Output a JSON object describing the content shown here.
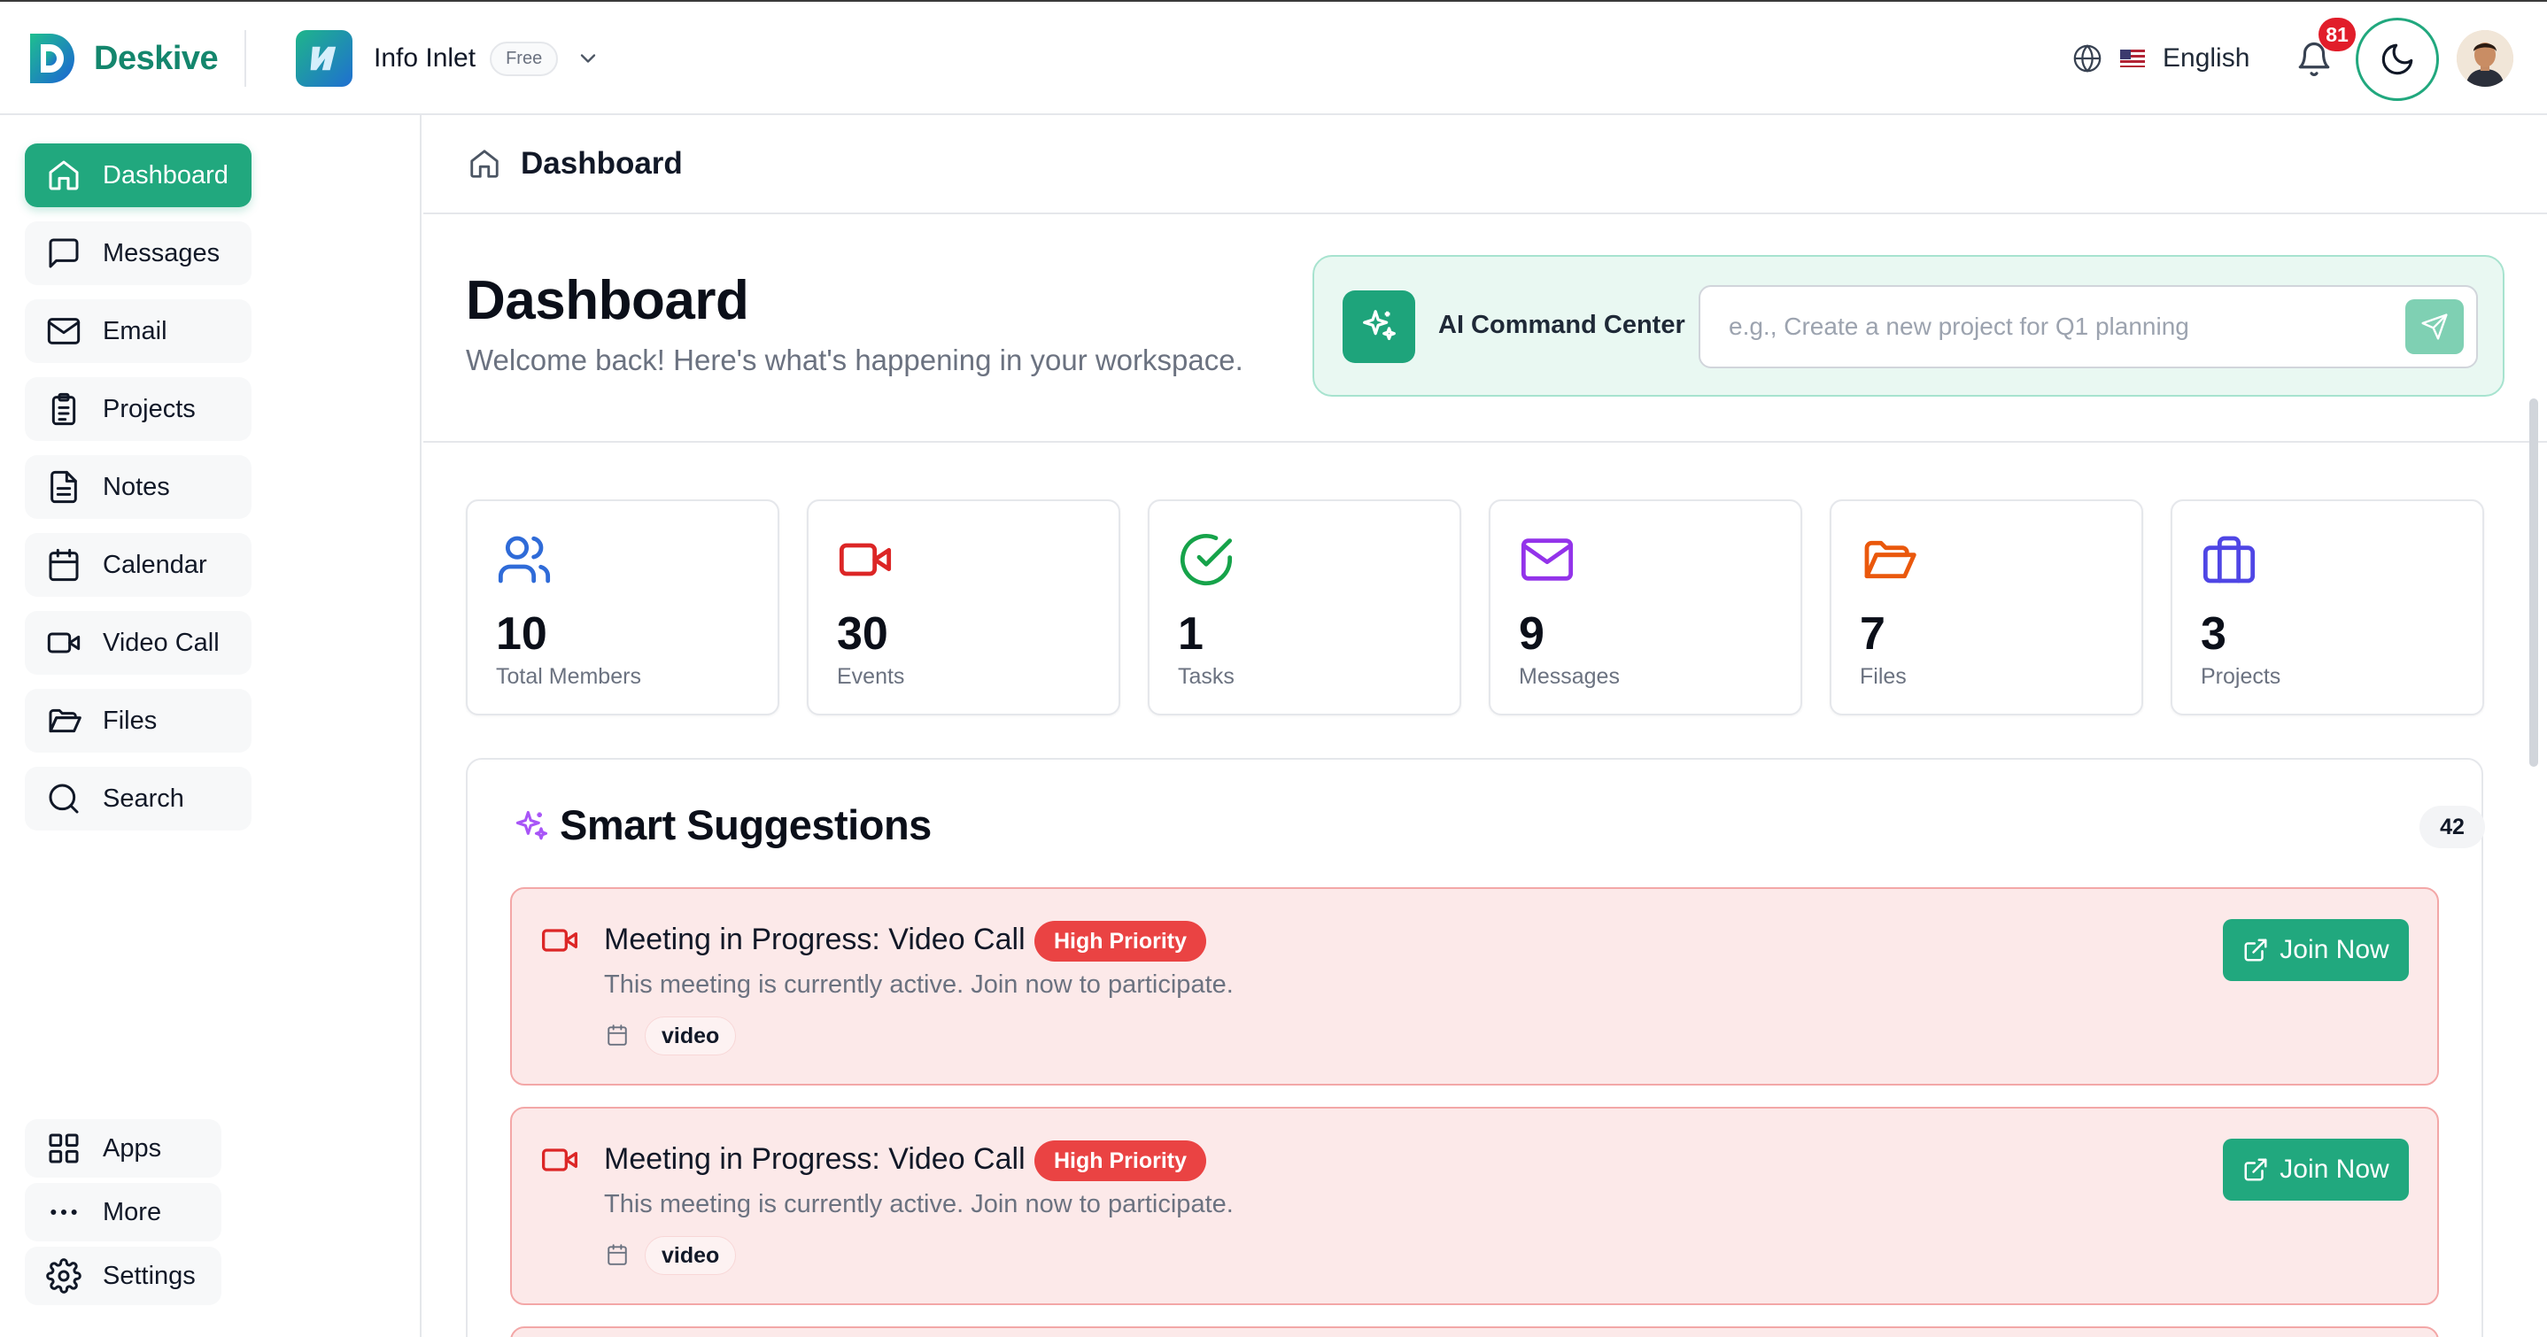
{
  "app": {
    "name": "Deskive"
  },
  "workspace": {
    "name": "Info Inlet",
    "plan": "Free"
  },
  "header": {
    "language": "English",
    "notifications_count": "81"
  },
  "sidebar": {
    "items": [
      {
        "label": "Dashboard",
        "icon": "home-icon"
      },
      {
        "label": "Messages",
        "icon": "message-square-icon"
      },
      {
        "label": "Email",
        "icon": "mail-icon"
      },
      {
        "label": "Projects",
        "icon": "clipboard-icon"
      },
      {
        "label": "Notes",
        "icon": "file-text-icon"
      },
      {
        "label": "Calendar",
        "icon": "calendar-icon"
      },
      {
        "label": "Video Call",
        "icon": "video-icon"
      },
      {
        "label": "Files",
        "icon": "folder-open-icon"
      },
      {
        "label": "Search",
        "icon": "search-icon"
      }
    ],
    "bottom": [
      {
        "label": "Apps",
        "icon": "grid-icon"
      },
      {
        "label": "More",
        "icon": "more-horizontal-icon"
      },
      {
        "label": "Settings",
        "icon": "settings-icon"
      }
    ]
  },
  "breadcrumb": {
    "label": "Dashboard"
  },
  "page": {
    "title": "Dashboard",
    "subtitle": "Welcome back! Here's what's happening in your workspace."
  },
  "ai": {
    "label": "AI Command Center",
    "placeholder": "e.g., Create a new project for Q1 planning"
  },
  "stats": [
    {
      "value": "10",
      "label": "Total Members",
      "icon": "users-icon",
      "color": "#2f6bd8"
    },
    {
      "value": "30",
      "label": "Events",
      "icon": "video-icon",
      "color": "#dc2626"
    },
    {
      "value": "1",
      "label": "Tasks",
      "icon": "check-circle-icon",
      "color": "#16a34a"
    },
    {
      "value": "9",
      "label": "Messages",
      "icon": "mail-icon",
      "color": "#9333ea"
    },
    {
      "value": "7",
      "label": "Files",
      "icon": "folder-open-icon",
      "color": "#ea580c"
    },
    {
      "value": "3",
      "label": "Projects",
      "icon": "briefcase-icon",
      "color": "#4f46e5"
    }
  ],
  "suggestions": {
    "title": "Smart Suggestions",
    "count": "42",
    "items": [
      {
        "title": "Meeting in Progress: Video Call",
        "priority": "High Priority",
        "description": "This meeting is currently active. Join now to participate.",
        "tag": "video",
        "action": "Join Now"
      },
      {
        "title": "Meeting in Progress: Video Call",
        "priority": "High Priority",
        "description": "This meeting is currently active. Join now to participate.",
        "tag": "video",
        "action": "Join Now"
      }
    ]
  },
  "colors": {
    "accent": "#21a87e",
    "brand_text": "#14866d",
    "priority_red": "#ea4343",
    "card_bg": "#fce9e9"
  }
}
